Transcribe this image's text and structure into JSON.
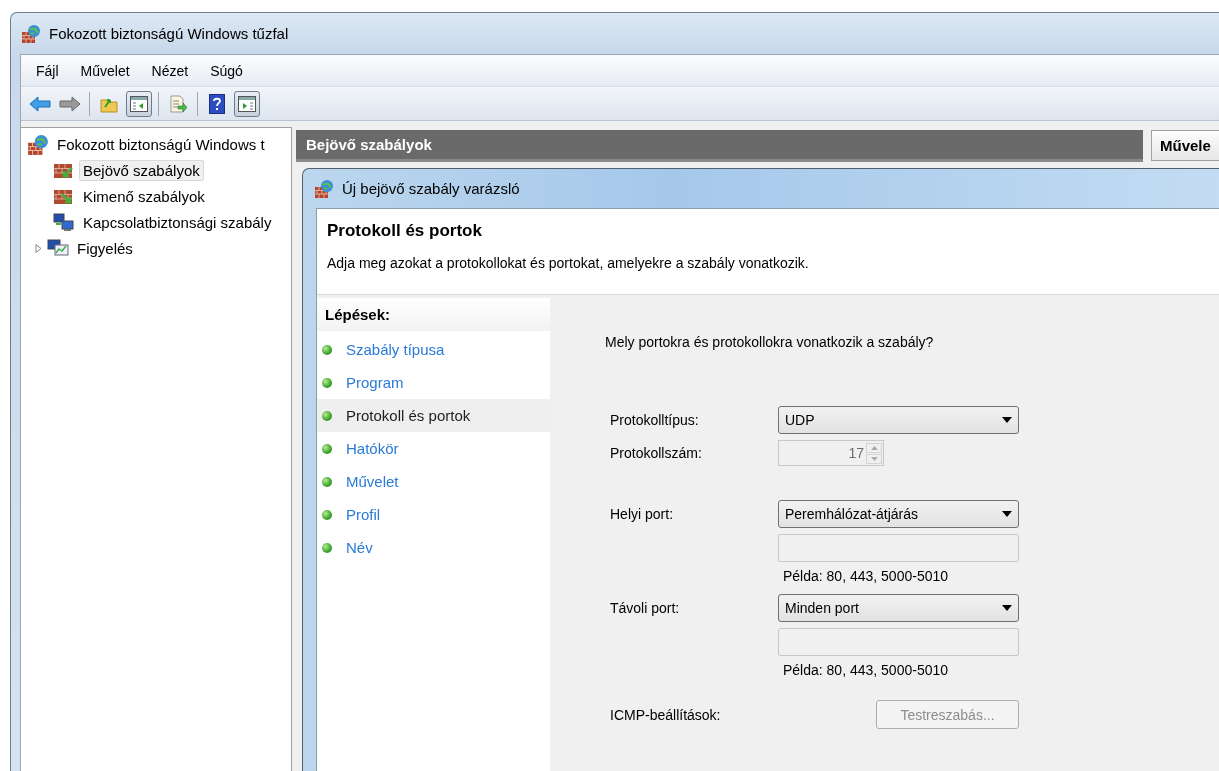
{
  "window": {
    "title": "Fokozott biztonságú Windows tűzfal"
  },
  "menu": [
    "Fájl",
    "Művelet",
    "Nézet",
    "Súgó"
  ],
  "toolbar": [
    [
      {
        "kind": "back",
        "pressed": false
      },
      {
        "kind": "forward",
        "pressed": false
      }
    ],
    [
      {
        "kind": "up",
        "pressed": false
      },
      {
        "kind": "tree",
        "pressed": true
      }
    ],
    [
      {
        "kind": "export",
        "pressed": false
      }
    ],
    [
      {
        "kind": "help",
        "pressed": false
      },
      {
        "kind": "actions",
        "pressed": true
      }
    ]
  ],
  "tree": {
    "label": "Fokozott biztonságú Windows t",
    "children": [
      {
        "label": "Bejövő szabályok",
        "kind": "inbound",
        "selected": true
      },
      {
        "label": "Kimenő szabályok",
        "kind": "outbound",
        "selected": false
      },
      {
        "label": "Kapcsolatbiztonsági szabály",
        "kind": "connection",
        "selected": false
      },
      {
        "label": "Figyelés",
        "kind": "monitor",
        "selected": false,
        "expanded": false
      }
    ]
  },
  "center_header": "Bejövő szabályok",
  "actions_header": "Művele",
  "wizard": {
    "title": "Új bejövő szabály varázsló",
    "heading": "Protokoll és portok",
    "description": "Adja meg azokat a protokollokat és portokat, amelyekre a szabály vonatkozik.",
    "steps_title": "Lépések:",
    "steps": [
      {
        "label": "Szabály típusa",
        "selected": false
      },
      {
        "label": "Program",
        "selected": false
      },
      {
        "label": "Protokoll és portok",
        "selected": true
      },
      {
        "label": "Hatókör",
        "selected": false
      },
      {
        "label": "Művelet",
        "selected": false
      },
      {
        "label": "Profil",
        "selected": false
      },
      {
        "label": "Név",
        "selected": false
      }
    ],
    "question": "Mely portokra és protokollokra vonatkozik a szabály?",
    "protocol_type": {
      "label": "Protokolltípus:",
      "value": "UDP"
    },
    "protocol_number": {
      "label": "Protokollszám:",
      "value": "17",
      "disabled": true
    },
    "ports": [
      {
        "label": "Helyi port:",
        "value": "Peremhálózat-átjárás",
        "entry_disabled": true,
        "example": "Példa: 80, 443, 5000-5010"
      },
      {
        "label": "Távoli port:",
        "value": "Minden port",
        "entry_disabled": true,
        "example": "Példa: 80, 443, 5000-5010"
      }
    ],
    "icmp": {
      "label": "ICMP-beállítások:",
      "button": "Testreszabás...",
      "disabled": true
    }
  }
}
